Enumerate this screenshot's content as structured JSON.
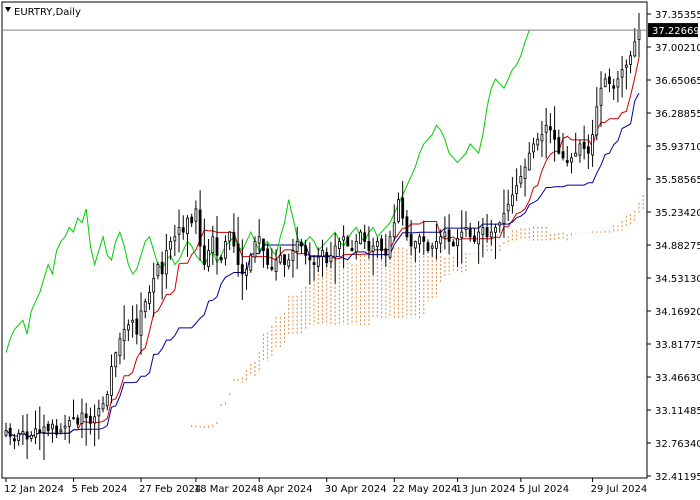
{
  "chart_data": {
    "type": "candlestick",
    "title": "EURTRY,Daily",
    "current_price": "37.22669",
    "ylim": [
      32.4,
      37.4
    ],
    "y_ticks": [
      "37.35355",
      "37.00210",
      "36.65065",
      "36.28855",
      "35.93710",
      "35.58565",
      "35.23420",
      "34.88275",
      "34.53130",
      "34.16920",
      "33.81775",
      "33.46630",
      "33.11485",
      "32.76340",
      "32.41195"
    ],
    "x_ticks": [
      "12 Jan 2024",
      "5 Feb 2024",
      "27 Feb 2024",
      "18 Mar 2024",
      "8 Apr 2024",
      "30 Apr 2024",
      "22 May 2024",
      "13 Jun 2024",
      "5 Jul 2024",
      "29 Jul 2024"
    ],
    "x_tick_bars": [
      0,
      16,
      32,
      45,
      60,
      76,
      92,
      107,
      122,
      139
    ],
    "num_bars": 151,
    "closes": [
      32.91,
      32.85,
      32.8,
      32.88,
      32.9,
      32.82,
      32.86,
      32.93,
      32.89,
      32.95,
      32.91,
      32.98,
      32.87,
      32.92,
      32.96,
      33.02,
      33.05,
      32.98,
      33.1,
      33.05,
      32.99,
      33.06,
      33.15,
      33.2,
      33.3,
      33.6,
      33.75,
      33.9,
      34.0,
      34.05,
      34.1,
      33.95,
      34.2,
      34.3,
      34.4,
      34.55,
      34.7,
      34.6,
      34.85,
      34.95,
      35.0,
      35.1,
      35.05,
      35.2,
      35.15,
      35.3,
      34.9,
      34.7,
      34.85,
      35.0,
      34.8,
      34.75,
      34.95,
      35.05,
      34.9,
      34.7,
      34.6,
      34.65,
      34.8,
      34.95,
      35.0,
      34.85,
      34.7,
      34.65,
      34.75,
      34.8,
      34.7,
      34.75,
      34.85,
      34.95,
      34.9,
      34.8,
      34.75,
      34.7,
      34.78,
      34.85,
      34.72,
      34.8,
      34.9,
      34.95,
      35.0,
      34.9,
      34.85,
      34.95,
      35.05,
      34.95,
      34.85,
      34.9,
      34.95,
      34.85,
      34.8,
      35.0,
      35.15,
      35.4,
      35.2,
      35.0,
      34.9,
      34.95,
      35.0,
      34.95,
      34.85,
      34.9,
      34.95,
      35.0,
      35.05,
      34.95,
      34.9,
      34.98,
      35.05,
      35.1,
      35.0,
      34.95,
      35.05,
      35.1,
      35.0,
      35.05,
      35.1,
      35.15,
      35.25,
      35.35,
      35.45,
      35.55,
      35.65,
      35.75,
      35.9,
      36.0,
      36.05,
      36.1,
      36.2,
      36.15,
      36.05,
      35.9,
      35.85,
      35.8,
      35.85,
      35.9,
      36.0,
      35.95,
      35.9,
      36.1,
      36.4,
      36.6,
      36.7,
      36.65,
      36.6,
      36.7,
      36.8,
      36.85,
      36.95,
      37.1,
      37.22669
    ],
    "indicators": [
      {
        "name": "Tenkan-sen",
        "color": "#cc0000"
      },
      {
        "name": "Kijun-sen",
        "color": "#000099"
      },
      {
        "name": "Chikou Span",
        "color": "#00cc00"
      },
      {
        "name": "Senkou Span",
        "color": "#e08a3c"
      }
    ]
  }
}
